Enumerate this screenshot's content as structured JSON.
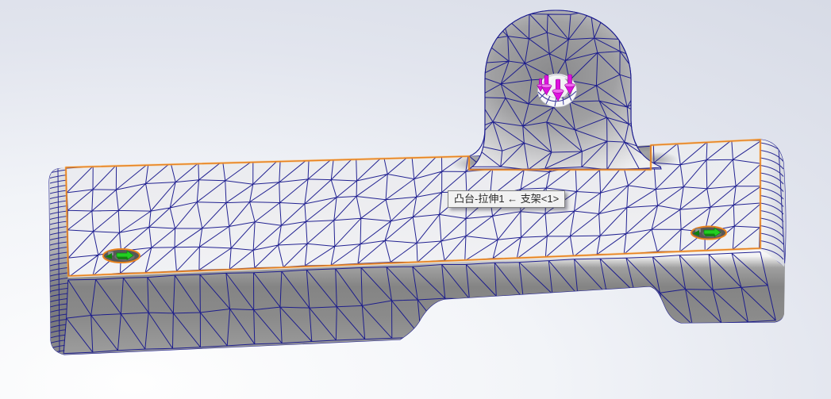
{
  "viewport": {
    "kind": "cad-3d-viewport",
    "tooltip": {
      "text": "凸台-拉伸1 ← 支架<1>"
    },
    "colors": {
      "mesh_line": "#17178c",
      "outline": "#1a1a8e",
      "highlight_edge": "#e8821e",
      "highlight_glow": "#ffb14e",
      "load_arrow": "#df12df",
      "load_arrow_dark": "#8f008f",
      "fixture_green": "#21cf21",
      "fixture_green_dark": "#0e7f0e",
      "hole_interior": "#575757",
      "background_corner": "#d7dbe6",
      "background_center": "#fdfdfe"
    },
    "symbols": {
      "loads": {
        "icon": "bearing-load-arrow-icon",
        "count": 4,
        "location": "boss-top-hole"
      },
      "fixtures": {
        "icon": "fixture-arrow-icon",
        "count": 2,
        "locations": [
          "left-slot-hole",
          "right-slot-hole"
        ]
      }
    },
    "mesh": {
      "style": "triangular-shell-mesh"
    }
  }
}
